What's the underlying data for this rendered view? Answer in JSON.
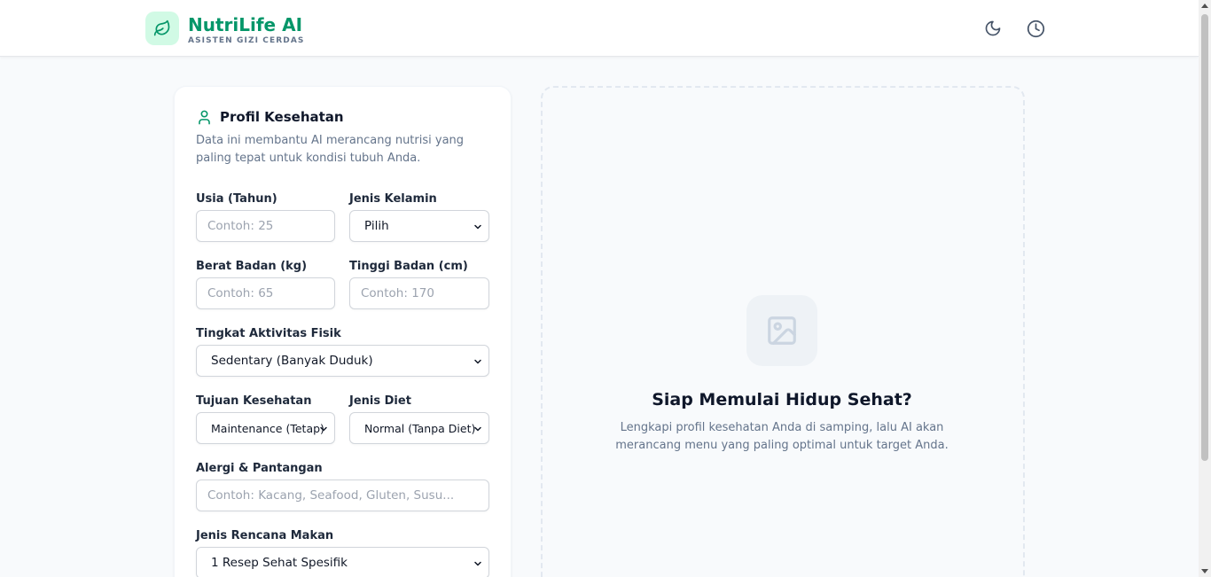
{
  "header": {
    "brand_name": "NutriLife AI",
    "brand_tagline": "ASISTEN GIZI CERDAS",
    "logo_icon": "leaf-icon",
    "theme_toggle_icon": "moon-icon",
    "history_icon": "clock-icon"
  },
  "profile_form": {
    "title": "Profil Kesehatan",
    "description": "Data ini membantu AI merancang nutrisi yang paling tepat untuk kondisi tubuh Anda.",
    "age": {
      "label": "Usia (Tahun)",
      "placeholder": "Contoh: 25",
      "value": ""
    },
    "gender": {
      "label": "Jenis Kelamin",
      "selected": "Pilih"
    },
    "weight": {
      "label": "Berat Badan (kg)",
      "placeholder": "Contoh: 65",
      "value": ""
    },
    "height": {
      "label": "Tinggi Badan (cm)",
      "placeholder": "Contoh: 170",
      "value": ""
    },
    "activity": {
      "label": "Tingkat Aktivitas Fisik",
      "selected": "Sedentary (Banyak Duduk)"
    },
    "goal": {
      "label": "Tujuan Kesehatan",
      "selected": "Maintenance (Tetap)"
    },
    "diet": {
      "label": "Jenis Diet",
      "selected": "Normal (Tanpa Diet)"
    },
    "allergies": {
      "label": "Alergi & Pantangan",
      "placeholder": "Contoh: Kacang, Seafood, Gluten, Susu...",
      "value": ""
    },
    "plan_type": {
      "label": "Jenis Rencana Makan",
      "selected": "1 Resep Sehat Spesifik"
    }
  },
  "empty_state": {
    "icon": "image-icon",
    "title": "Siap Memulai Hidup Sehat?",
    "text": "Lengkapi profil kesehatan Anda di samping, lalu AI akan merancang menu yang paling optimal untuk target Anda."
  },
  "colors": {
    "brand": "#059669",
    "brand_bg": "#d1fae5",
    "page_bg": "#f8fafc"
  }
}
